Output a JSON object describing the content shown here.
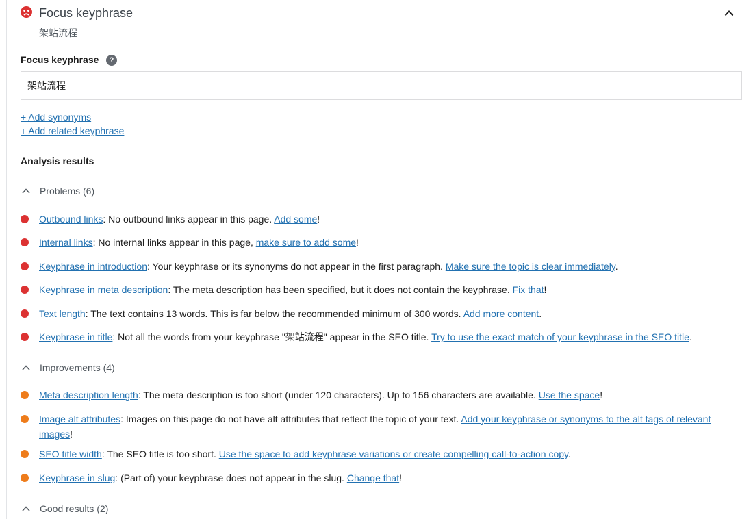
{
  "header": {
    "title": "Focus keyphrase",
    "keyphrase": "架站流程"
  },
  "field": {
    "label": "Focus keyphrase",
    "help_glyph": "?",
    "value": "架站流程"
  },
  "links": {
    "add_synonyms": "+ Add synonyms",
    "add_related": "+ Add related keyphrase"
  },
  "analysis": {
    "title": "Analysis results",
    "problems_label": "Problems (6)",
    "improvements_label": "Improvements (4)",
    "good_label": "Good results (2)",
    "problems": [
      {
        "link": "Outbound links",
        "text": ": No outbound links appear in this page. ",
        "action": "Add some",
        "end": "!"
      },
      {
        "link": "Internal links",
        "text": ": No internal links appear in this page, ",
        "action": "make sure to add some",
        "end": "!"
      },
      {
        "link": "Keyphrase in introduction",
        "text": ": Your keyphrase or its synonyms do not appear in the first paragraph. ",
        "action": "Make sure the topic is clear immediately",
        "end": "."
      },
      {
        "link": "Keyphrase in meta description",
        "text": ": The meta description has been specified, but it does not contain the keyphrase. ",
        "action": "Fix that",
        "end": "!"
      },
      {
        "link": "Text length",
        "text": ": The text contains 13 words. This is far below the recommended minimum of 300 words. ",
        "action": "Add more content",
        "end": "."
      },
      {
        "link": "Keyphrase in title",
        "text": ": Not all the words from your keyphrase \"架站流程\" appear in the SEO title. ",
        "action": "Try to use the exact match of your keyphrase in the SEO title",
        "end": "."
      }
    ],
    "improvements": [
      {
        "link": "Meta description length",
        "text": ": The meta description is too short (under 120 characters). Up to 156 characters are available. ",
        "action": "Use the space",
        "end": "!"
      },
      {
        "link": "Image alt attributes",
        "text": ": Images on this page do not have alt attributes that reflect the topic of your text. ",
        "action": "Add your keyphrase or synonyms to the alt tags of relevant images",
        "end": "!"
      },
      {
        "link": "SEO title width",
        "text": ": The SEO title is too short. ",
        "action": "Use the space to add keyphrase variations or create compelling call-to-action copy",
        "end": "."
      },
      {
        "link": "Keyphrase in slug",
        "text": ": (Part of) your keyphrase does not appear in the slug. ",
        "action": "Change that",
        "end": "!"
      }
    ]
  },
  "colors": {
    "problem": "#dc3232",
    "improvement": "#ee7c1b",
    "link": "#2271b1",
    "face": "#dc3232"
  },
  "icons": {
    "header": "sad-face-icon",
    "collapse": "chevron-up-icon",
    "help": "question-circle-icon"
  }
}
